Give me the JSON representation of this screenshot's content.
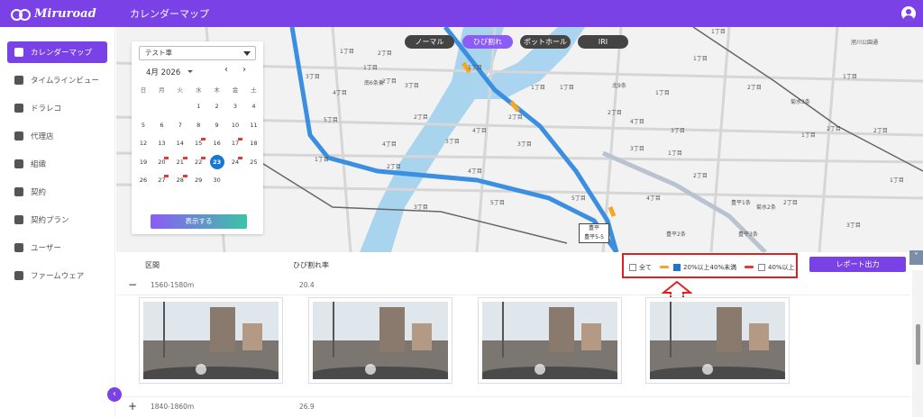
{
  "app": {
    "logo": "Miruroad",
    "title": "カレンダーマップ"
  },
  "sidebar": {
    "items": [
      {
        "label": "カレンダーマップ",
        "icon": "map-icon"
      },
      {
        "label": "タイムラインビュー",
        "icon": "image-icon"
      },
      {
        "label": "ドラレコ",
        "icon": "car-icon"
      },
      {
        "label": "代理店",
        "icon": "building-icon"
      },
      {
        "label": "組織",
        "icon": "sitemap-icon"
      },
      {
        "label": "契約",
        "icon": "document-icon"
      },
      {
        "label": "契約プラン",
        "icon": "layers-icon"
      },
      {
        "label": "ユーザー",
        "icon": "user-icon"
      },
      {
        "label": "ファームウェア",
        "icon": "file-icon"
      }
    ]
  },
  "map": {
    "modes": [
      "ノーマル",
      "ひび割れ",
      "ポットホール",
      "IRI"
    ],
    "active_mode": "ひび割れ",
    "labels": [
      "1丁目",
      "2丁目",
      "3丁目",
      "4丁目",
      "5丁目",
      "1丁目",
      "2丁目",
      "南6条東",
      "3丁目",
      "4丁目",
      "1丁目",
      "2丁目",
      "3丁目",
      "1丁目",
      "2丁目",
      "3丁目",
      "4丁目",
      "1丁目",
      "2丁目",
      "3丁目",
      "4丁目",
      "5丁目",
      "北9条",
      "1丁目",
      "2丁目",
      "3丁目",
      "4丁目",
      "5丁目",
      "菊水3条",
      "1丁目",
      "豊平1条",
      "豊平2条",
      "2丁目",
      "菊水2条",
      "豊平3条",
      "1丁目",
      "1丁目",
      "2丁目",
      "3丁目",
      "4丁目",
      "1丁目",
      "2丁目",
      "1丁目",
      "2丁目",
      "1丁目",
      "旭川公園通",
      "1丁目",
      "2丁目",
      "3丁目"
    ],
    "sign": [
      "豊平",
      "豊平5-5"
    ]
  },
  "calendar": {
    "vehicle": "テスト車",
    "month": "4月 2026",
    "weekdays": [
      "日",
      "月",
      "火",
      "水",
      "木",
      "金",
      "土"
    ],
    "weeks": [
      [
        "",
        "",
        "",
        "1",
        "2",
        "3",
        "4"
      ],
      [
        "5",
        "6",
        "7",
        "8",
        "9",
        "10",
        "11"
      ],
      [
        "12",
        "13",
        "14",
        "15",
        "16",
        "17",
        "18"
      ],
      [
        "19",
        "20",
        "21",
        "22",
        "23",
        "24",
        "25"
      ],
      [
        "26",
        "27",
        "28",
        "29",
        "30",
        "",
        ""
      ]
    ],
    "selected": "23",
    "flagged": [
      "15",
      "17",
      "20",
      "21",
      "22",
      "24",
      "27",
      "28"
    ],
    "show_label": "表示する"
  },
  "table": {
    "headers": [
      "区間",
      "ひび割れ率"
    ],
    "filters": [
      {
        "label": "全て",
        "checked": false,
        "color": ""
      },
      {
        "label": "20%以上40%未満",
        "checked": true,
        "color": "#f5a623"
      },
      {
        "label": "40%以上",
        "checked": false,
        "color": "#e53935"
      }
    ],
    "report_label": "レポート出力",
    "rows": [
      {
        "toggle": "−",
        "range": "1560-1580m",
        "rate": "20.4",
        "expanded": true
      },
      {
        "toggle": "+",
        "range": "1840-1860m",
        "rate": "26.9",
        "expanded": false
      }
    ]
  },
  "colors": {
    "accent": "#7a42e6",
    "route": "#3b8fe0",
    "crack_mid": "#f5a623",
    "crack_high": "#e53935"
  }
}
